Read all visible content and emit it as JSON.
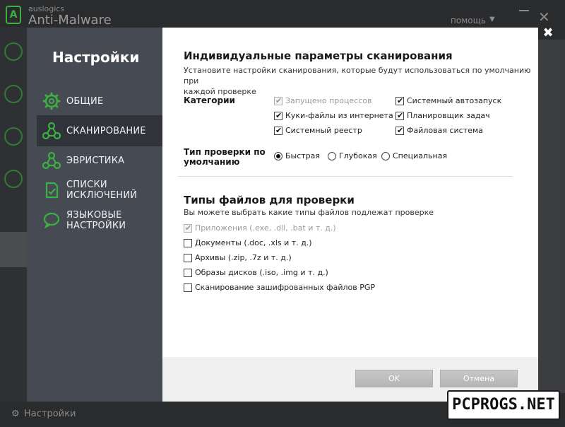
{
  "background_app": {
    "brand_small": "auslogics",
    "brand_big": "Anti-Malware",
    "help_menu": "помощь",
    "footer_settings": "Настройки"
  },
  "sidebar": {
    "title": "Настройки",
    "accent_color": "#3cb043",
    "items": [
      {
        "label": "ОБЩИЕ",
        "icon": "gear-icon",
        "active": false
      },
      {
        "label": "СКАНИРОВАНИЕ",
        "icon": "network-nodes-icon",
        "active": true
      },
      {
        "label": "ЭВРИСТИКА",
        "icon": "network-nodes-icon",
        "active": false
      },
      {
        "label_line1": "СПИСКИ",
        "label_line2": "ИСКЛЮЧЕНИЙ",
        "icon": "document-check-icon",
        "active": false
      },
      {
        "label_line1": "ЯЗЫКОВЫЕ",
        "label_line2": "НАСТРОЙКИ",
        "icon": "speech-bubble-icon",
        "active": false
      }
    ]
  },
  "scan_params": {
    "title": "Индивидуальные параметры сканирования",
    "desc_line1": "Установите настройки сканирования, которые будут использоваться по умолчанию при",
    "desc_line2": "каждой проверке",
    "categories_label": "Категории",
    "categories": [
      {
        "label": "Запущено процессов",
        "checked": true,
        "disabled": true
      },
      {
        "label": "Куки-файлы из интернета",
        "checked": true,
        "disabled": false
      },
      {
        "label": "Системный реестр",
        "checked": true,
        "disabled": false
      },
      {
        "label": "Системный автозапуск",
        "checked": true,
        "disabled": false
      },
      {
        "label": "Планировщик задач",
        "checked": true,
        "disabled": false
      },
      {
        "label": "Файловая система",
        "checked": true,
        "disabled": false
      }
    ],
    "scan_type_label_line1": "Тип проверки по",
    "scan_type_label_line2": "умолчанию",
    "scan_types": [
      {
        "label": "Быстрая",
        "selected": true
      },
      {
        "label": "Глубокая",
        "selected": false
      },
      {
        "label": "Специальная",
        "selected": false
      }
    ]
  },
  "file_types": {
    "title": "Типы файлов для проверки",
    "desc": "Вы можете выбрать какие типы файлов подлежат проверке",
    "items": [
      {
        "label": "Приложения (.exe, .dll, .bat и т. д.)",
        "checked": true,
        "disabled": true
      },
      {
        "label": "Документы (.doc, .xls и т. д.)",
        "checked": false,
        "disabled": false
      },
      {
        "label": "Архивы (.zip, .7z и т. д.)",
        "checked": false,
        "disabled": false
      },
      {
        "label": "Образы дисков (.iso, .img и т. д.)",
        "checked": false,
        "disabled": false
      },
      {
        "label": "Сканирование зашифрованных файлов PGP",
        "checked": false,
        "disabled": false
      }
    ]
  },
  "buttons": {
    "ok": "OK",
    "cancel": "Отмена"
  },
  "watermark": "PCPROGS.NET"
}
